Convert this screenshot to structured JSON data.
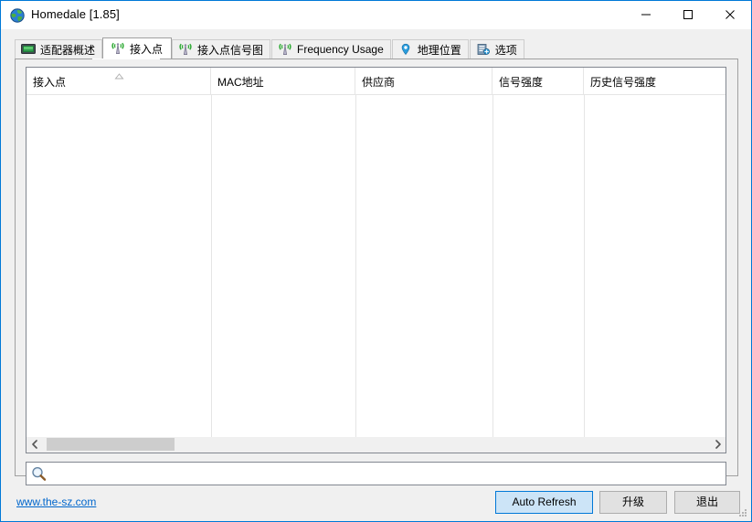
{
  "window": {
    "title": "Homedale [1.85]",
    "icon": "globe-icon",
    "controls": {
      "minimize": "minimize-icon",
      "maximize": "maximize-icon",
      "close": "close-icon"
    },
    "accent_color": "#0078d7",
    "background_color": "#f0f0f0"
  },
  "tabs": [
    {
      "label": "适配器概述",
      "icon": "network-adapter-icon",
      "selected": false
    },
    {
      "label": "接入点",
      "icon": "access-point-antenna-icon",
      "selected": true
    },
    {
      "label": "接入点信号图",
      "icon": "access-point-antenna-icon",
      "selected": false
    },
    {
      "label": "Frequency Usage",
      "icon": "access-point-antenna-icon",
      "selected": false
    },
    {
      "label": "地理位置",
      "icon": "map-pin-icon",
      "selected": false
    },
    {
      "label": "选项",
      "icon": "options-gear-icon",
      "selected": false
    }
  ],
  "table": {
    "columns": [
      {
        "label": "接入点",
        "sort": "ascending"
      },
      {
        "label": "MAC地址",
        "sort": ""
      },
      {
        "label": "供应商",
        "sort": ""
      },
      {
        "label": "信号强度",
        "sort": ""
      },
      {
        "label": "历史信号强度",
        "sort": ""
      }
    ],
    "rows": []
  },
  "scrollbar": {
    "left_arrow": "chevron-left-icon",
    "right_arrow": "chevron-right-icon"
  },
  "search": {
    "value": "",
    "placeholder": "",
    "icon": "magnifier-icon"
  },
  "footer": {
    "link": "www.the-sz.com",
    "auto_refresh_label": "Auto Refresh",
    "upgrade_label": "升级",
    "exit_label": "退出",
    "auto_refresh_color": "#cce4f7"
  }
}
